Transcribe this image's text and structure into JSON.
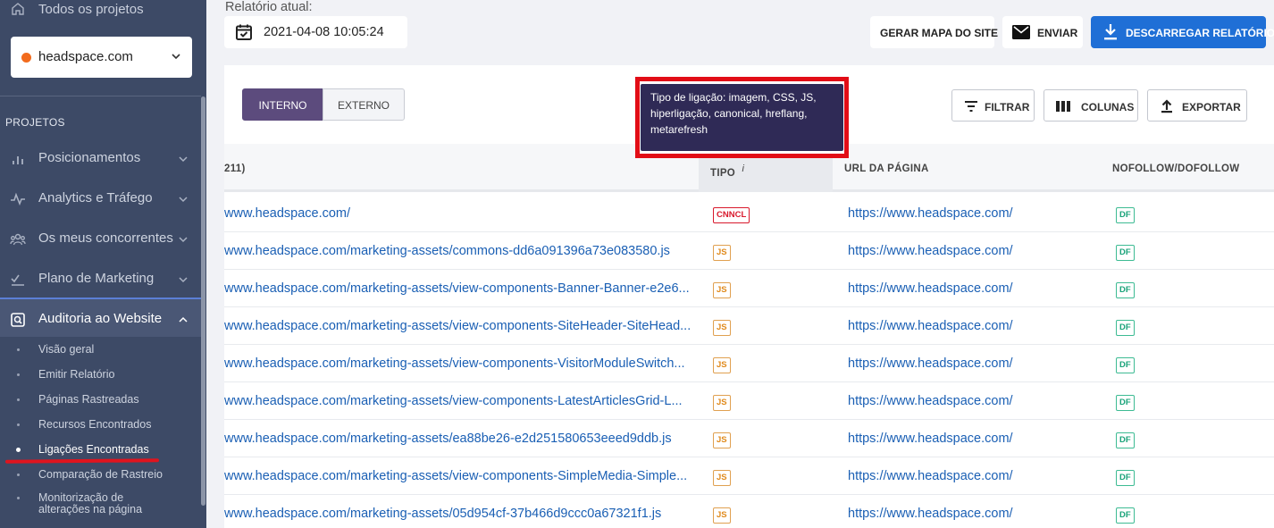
{
  "sidebar": {
    "all_projects": "Todos os projetos",
    "project": "headspace.com",
    "section_title": "PROJETOS",
    "nav": [
      {
        "label": "Posicionamentos"
      },
      {
        "label": "Analytics e Tráfego"
      },
      {
        "label": "Os meus concorrentes"
      },
      {
        "label": "Plano de Marketing"
      },
      {
        "label": "Auditoria ao Website"
      }
    ],
    "sub": [
      {
        "label": "Visão geral"
      },
      {
        "label": "Emitir Relatório"
      },
      {
        "label": "Páginas Rastreadas"
      },
      {
        "label": "Recursos Encontrados"
      },
      {
        "label": "Ligações Encontradas"
      },
      {
        "label": "Comparação de Rastreio"
      },
      {
        "label": "Monitorização de alterações na página"
      }
    ]
  },
  "header": {
    "report_label": "Relatório atual:",
    "report_date": "2021-04-08 10:05:24",
    "sitemap_button": "GERAR MAPA DO SITE",
    "send_button": "ENVIAR",
    "download_button": "DESCARREGAR RELATÓRIO"
  },
  "toolbar": {
    "tab_internal": "INTERNO",
    "tab_external": "EXTERNO",
    "filter": "FILTRAR",
    "columns": "COLUNAS",
    "export": "EXPORTAR"
  },
  "tooltip": "Tipo de ligação: imagem, CSS, JS, hiperligação, canonical, hreflang, metarefresh",
  "table": {
    "headers": {
      "link_partial": "211)",
      "type": "TIPO",
      "type_info": "i",
      "page_url": "URL DA PÁGINA",
      "nofollow": "NOFOLLOW/DOFOLLOW"
    },
    "rows": [
      {
        "url": "www.headspace.com/",
        "type": "CNNCL",
        "page": "https://www.headspace.com/",
        "follow": "DF"
      },
      {
        "url": "www.headspace.com/marketing-assets/commons-dd6a091396a73e083580.js",
        "type": "JS",
        "page": "https://www.headspace.com/",
        "follow": "DF"
      },
      {
        "url": "www.headspace.com/marketing-assets/view-components-Banner-Banner-e2e6...",
        "type": "JS",
        "page": "https://www.headspace.com/",
        "follow": "DF"
      },
      {
        "url": "www.headspace.com/marketing-assets/view-components-SiteHeader-SiteHead...",
        "type": "JS",
        "page": "https://www.headspace.com/",
        "follow": "DF"
      },
      {
        "url": "www.headspace.com/marketing-assets/view-components-VisitorModuleSwitch...",
        "type": "JS",
        "page": "https://www.headspace.com/",
        "follow": "DF"
      },
      {
        "url": "www.headspace.com/marketing-assets/view-components-LatestArticlesGrid-L...",
        "type": "JS",
        "page": "https://www.headspace.com/",
        "follow": "DF"
      },
      {
        "url": "www.headspace.com/marketing-assets/ea88be26-e2d251580653eeed9ddb.js",
        "type": "JS",
        "page": "https://www.headspace.com/",
        "follow": "DF"
      },
      {
        "url": "www.headspace.com/marketing-assets/view-components-SimpleMedia-Simple...",
        "type": "JS",
        "page": "https://www.headspace.com/",
        "follow": "DF"
      },
      {
        "url": "www.headspace.com/marketing-assets/05d954cf-37b466d9ccc0a67321f1.js",
        "type": "JS",
        "page": "https://www.headspace.com/",
        "follow": "DF"
      }
    ]
  },
  "colors": {
    "sidebar_bg": "#3d4a66",
    "accent": "#5c4b7d",
    "primary_button": "#1f6fd6",
    "link": "#1a5fb4",
    "highlight_red": "#e20d16"
  }
}
